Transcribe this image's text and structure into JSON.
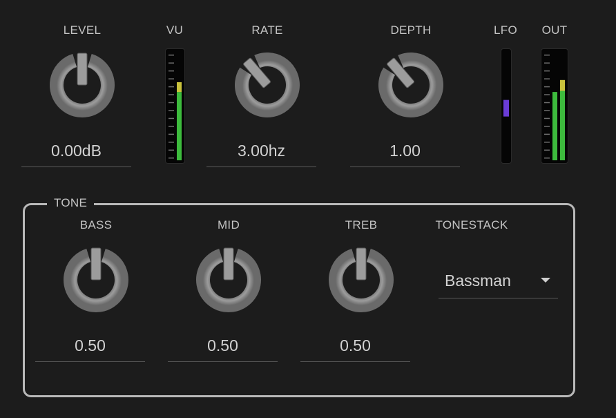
{
  "controls": {
    "level": {
      "label": "LEVEL",
      "value": "0.00dB",
      "position": 0.5
    },
    "rate": {
      "label": "RATE",
      "value": "3.00hz",
      "position": 0.35
    },
    "depth": {
      "label": "DEPTH",
      "value": "1.00",
      "position": 0.35
    }
  },
  "meters": {
    "vu": {
      "label": "VU",
      "level": 0.63,
      "peak": 0.72
    },
    "lfo": {
      "label": "LFO",
      "level": 0.48
    },
    "out": {
      "label": "OUT",
      "left_level": 0.63,
      "right_level": 0.74,
      "peak": 0.74
    }
  },
  "tone": {
    "title": "TONE",
    "bass": {
      "label": "BASS",
      "value": "0.50",
      "position": 0.5
    },
    "mid": {
      "label": "MID",
      "value": "0.50",
      "position": 0.5
    },
    "treb": {
      "label": "TREB",
      "value": "0.50",
      "position": 0.5
    },
    "tonestack": {
      "label": "TONESTACK",
      "selected": "Bassman"
    }
  },
  "colors": {
    "meter_green": "#3dbb3d",
    "meter_yellow": "#c9c23c",
    "lfo_purple": "#6a3cd6",
    "knob_face": "#9c9c9c"
  }
}
